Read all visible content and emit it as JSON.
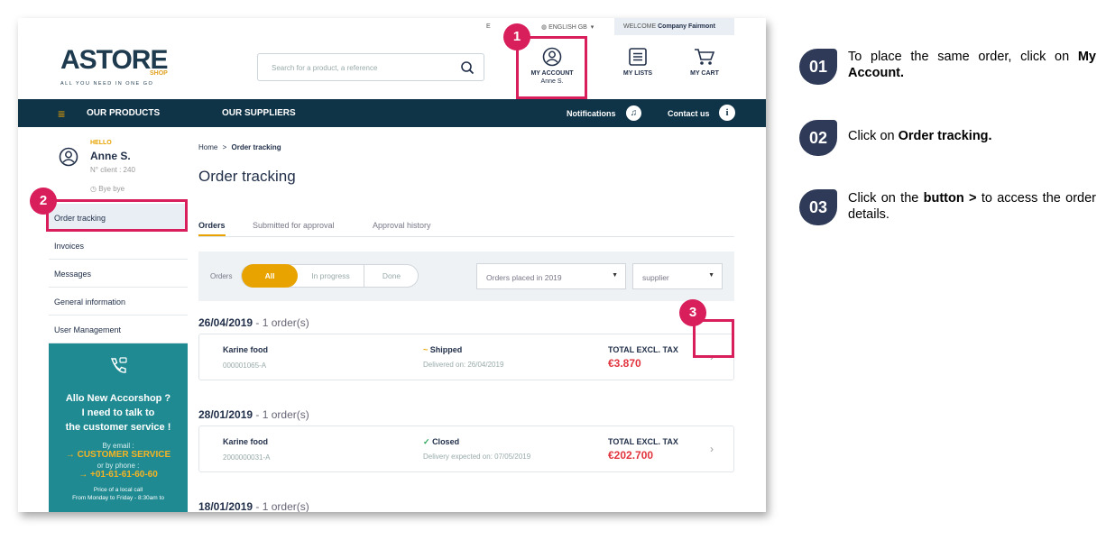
{
  "topbar": {
    "lang_short": "E",
    "language": "ENGLISH GB",
    "welcome": "WELCOME",
    "company": "Company Fairmont"
  },
  "logo": {
    "brand": "ASTORE",
    "sub": "SHOP",
    "tagline": "ALL YOU NEED IN ONE GO"
  },
  "search": {
    "placeholder": "Search for a product, a reference"
  },
  "header": {
    "account_label": "MY ACCOUNT",
    "account_user": "Anne S.",
    "lists_label": "MY LISTS",
    "cart_label": "MY CART"
  },
  "nav": {
    "products": "OUR PRODUCTS",
    "suppliers": "OUR SUPPLIERS",
    "notifications": "Notifications",
    "contact": "Contact us"
  },
  "sidebar": {
    "hello": "HELLO",
    "name": "Anne S.",
    "client": "N° client : 240",
    "byebye": "Bye bye",
    "items": [
      "Order tracking",
      "Invoices",
      "Messages",
      "General information",
      "User Management"
    ],
    "promo": {
      "line1": "Allo New Accorshop ?",
      "line2": "I need to talk to",
      "line3": "the customer service !",
      "by_email": "By email :",
      "service": "CUSTOMER SERVICE",
      "by_phone": "or by phone :",
      "phone": "+01-61-61-60-60",
      "price": "Price of a local call",
      "hours": "From Monday to Friday - 8:30am to"
    }
  },
  "main": {
    "breadcrumb_home": "Home",
    "breadcrumb_sep": ">",
    "breadcrumb_current": "Order tracking",
    "title": "Order tracking",
    "tabs": [
      "Orders",
      "Submitted for approval",
      "Approval history"
    ],
    "filter": {
      "label": "Orders",
      "options": [
        "All",
        "In progress",
        "Done"
      ],
      "period": "Orders placed in 2019",
      "supplier": "supplier"
    },
    "groups": [
      {
        "date": "26/04/2019",
        "count": "- 1 order(s)",
        "supplier": "Karine food",
        "ref": "000001065-A",
        "status_icon": "~",
        "status": "Shipped",
        "status_detail": "Delivered on: 26/04/2019",
        "total_label": "TOTAL EXCL. TAX",
        "total": "€3.870"
      },
      {
        "date": "28/01/2019",
        "count": "- 1 order(s)",
        "supplier": "Karine food",
        "ref": "2000000031-A",
        "status_icon": "✓",
        "status": "Closed",
        "status_detail": "Delivery expected on: 07/05/2019",
        "total_label": "TOTAL EXCL. TAX",
        "total": "€202.700"
      },
      {
        "date": "18/01/2019",
        "count": "- 1 order(s)"
      }
    ]
  },
  "callouts": [
    "1",
    "2",
    "3"
  ],
  "steps": [
    {
      "num": "01",
      "pre": "To place the same order, click on ",
      "bold": "My Account.",
      "post": ""
    },
    {
      "num": "02",
      "pre": "Click on ",
      "bold": "Order tracking.",
      "post": ""
    },
    {
      "num": "03",
      "pre": "Click on the ",
      "bold": "button >",
      "post": " to access the order details."
    }
  ],
  "colors": {
    "navy": "#0f3347",
    "accent": "#e8a300",
    "teal": "#1f8a92",
    "callout": "#d81e5b",
    "price": "#e2343e",
    "step": "#2e3a57"
  }
}
